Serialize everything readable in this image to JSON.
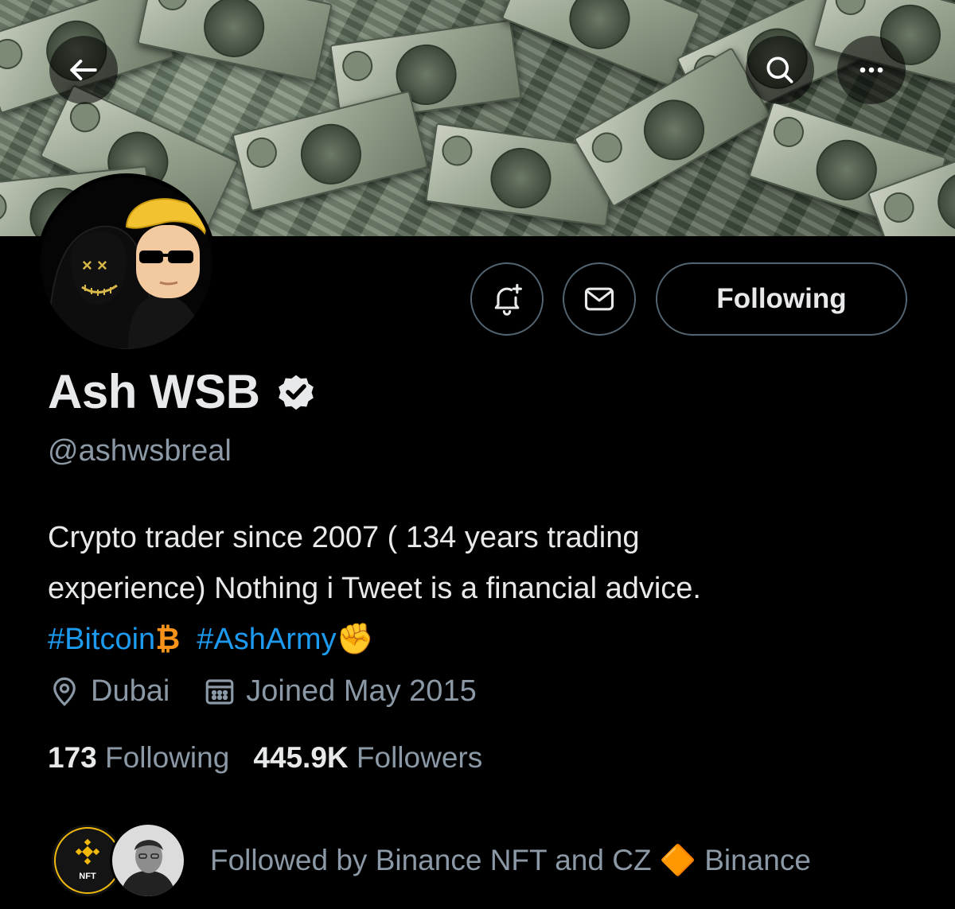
{
  "profile": {
    "name": "Ash WSB",
    "handle": "@ashwsbreal",
    "bio_line1": "Crypto trader since 2007 ( 134 years trading",
    "bio_line2": "experience) Nothing i Tweet is a financial advice.",
    "bio_tag1": "#Bitcoin",
    "bio_tag1_emoji": "₿",
    "bio_tag2": "#AshArmy",
    "bio_tag2_emoji": "✊",
    "location": "Dubai",
    "joined": "Joined May 2015"
  },
  "actions": {
    "follow_label": "Following"
  },
  "stats": {
    "following_count": "173",
    "following_label": "Following",
    "followers_count": "445.9K",
    "followers_label": "Followers"
  },
  "followed_by": {
    "text": "Followed by Binance NFT and CZ 🔶 Binance",
    "avatar1_label": "NFT"
  },
  "icons": {
    "back": "arrow-left-icon",
    "search": "search-icon",
    "more": "more-dots-icon",
    "notify": "bell-plus-icon",
    "message": "envelope-icon",
    "verified": "verified-badge-icon",
    "location": "location-pin-icon",
    "calendar": "calendar-icon"
  },
  "colors": {
    "background": "#000000",
    "link": "#1d9bf0",
    "secondary_text": "#8b98a5",
    "button_border": "#536471"
  }
}
